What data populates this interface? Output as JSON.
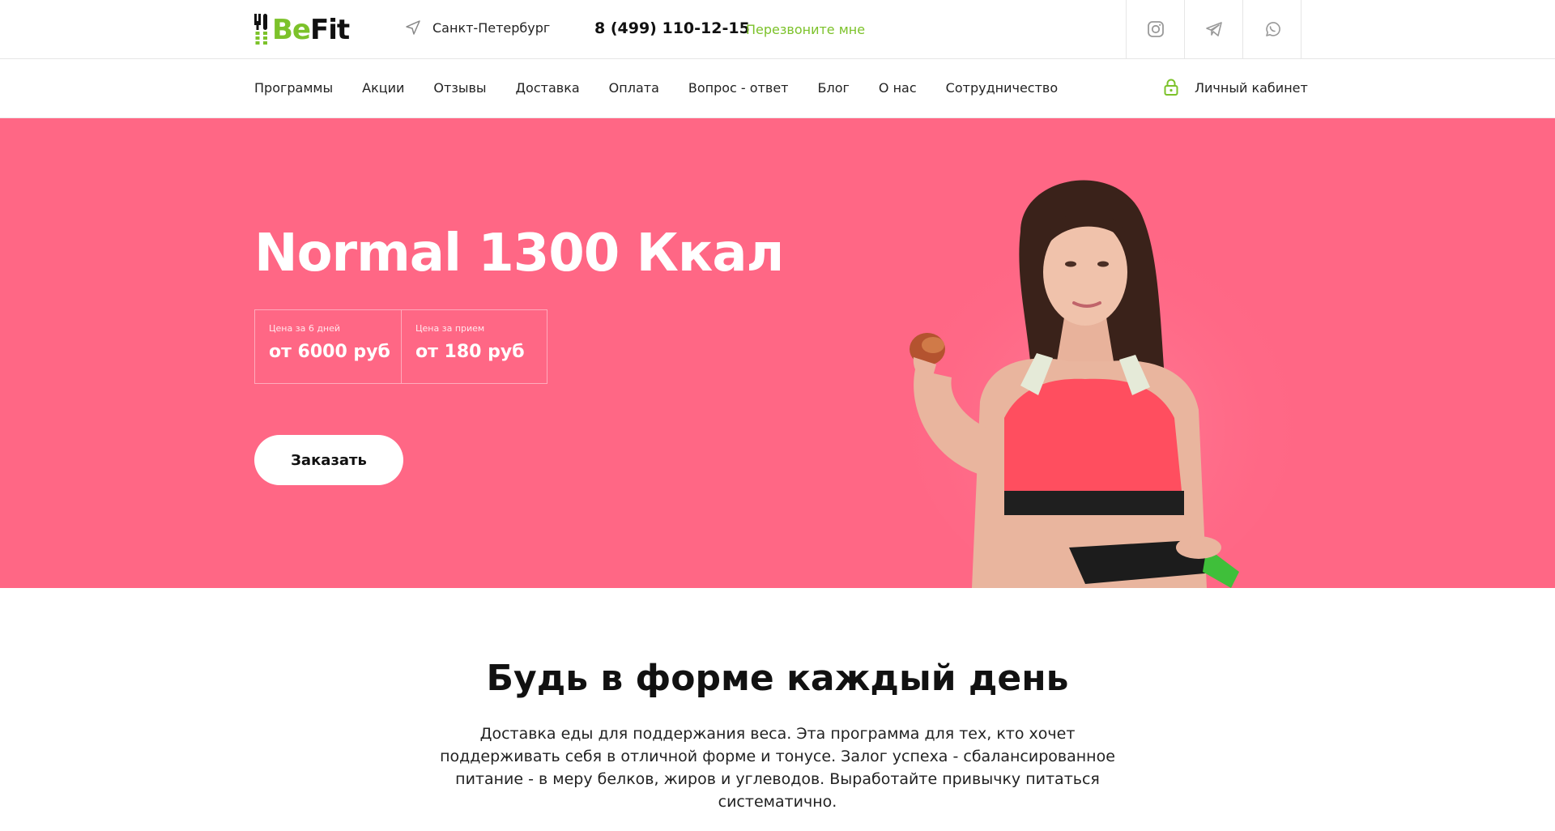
{
  "header": {
    "logo_be": "Be",
    "logo_fit": "Fit",
    "city": "Санкт-Петербург",
    "phone": "8 (499) 110-12-15",
    "callback": "Перезвоните мне",
    "socials": [
      "instagram-icon",
      "telegram-icon",
      "whatsapp-icon"
    ]
  },
  "nav": {
    "items": [
      "Программы",
      "Акции",
      "Отзывы",
      "Доставка",
      "Оплата",
      "Вопрос - ответ",
      "Блог",
      "О нас",
      "Сотрудничество"
    ],
    "account": "Личный кабинет"
  },
  "hero": {
    "title": "Normal 1300 Ккал",
    "prices": [
      {
        "label": "Цена за 6 дней",
        "value": "от 6000 руб"
      },
      {
        "label": "Цена за прием",
        "value": "от 180 руб"
      }
    ],
    "order_button": "Заказать",
    "background_color": "#ff6785"
  },
  "intro": {
    "title": "Будь в форме каждый день",
    "text": "Доставка еды для поддержания веса. Эта программа для тех, кто хочет поддерживать себя в отличной форме и тонусе. Залог успеха - сбалансированное питание - в меру белков, жиров и углеводов. Выработайте привычку питаться систематично."
  },
  "colors": {
    "accent_green": "#7cc22a",
    "hero_pink": "#ff6785"
  }
}
